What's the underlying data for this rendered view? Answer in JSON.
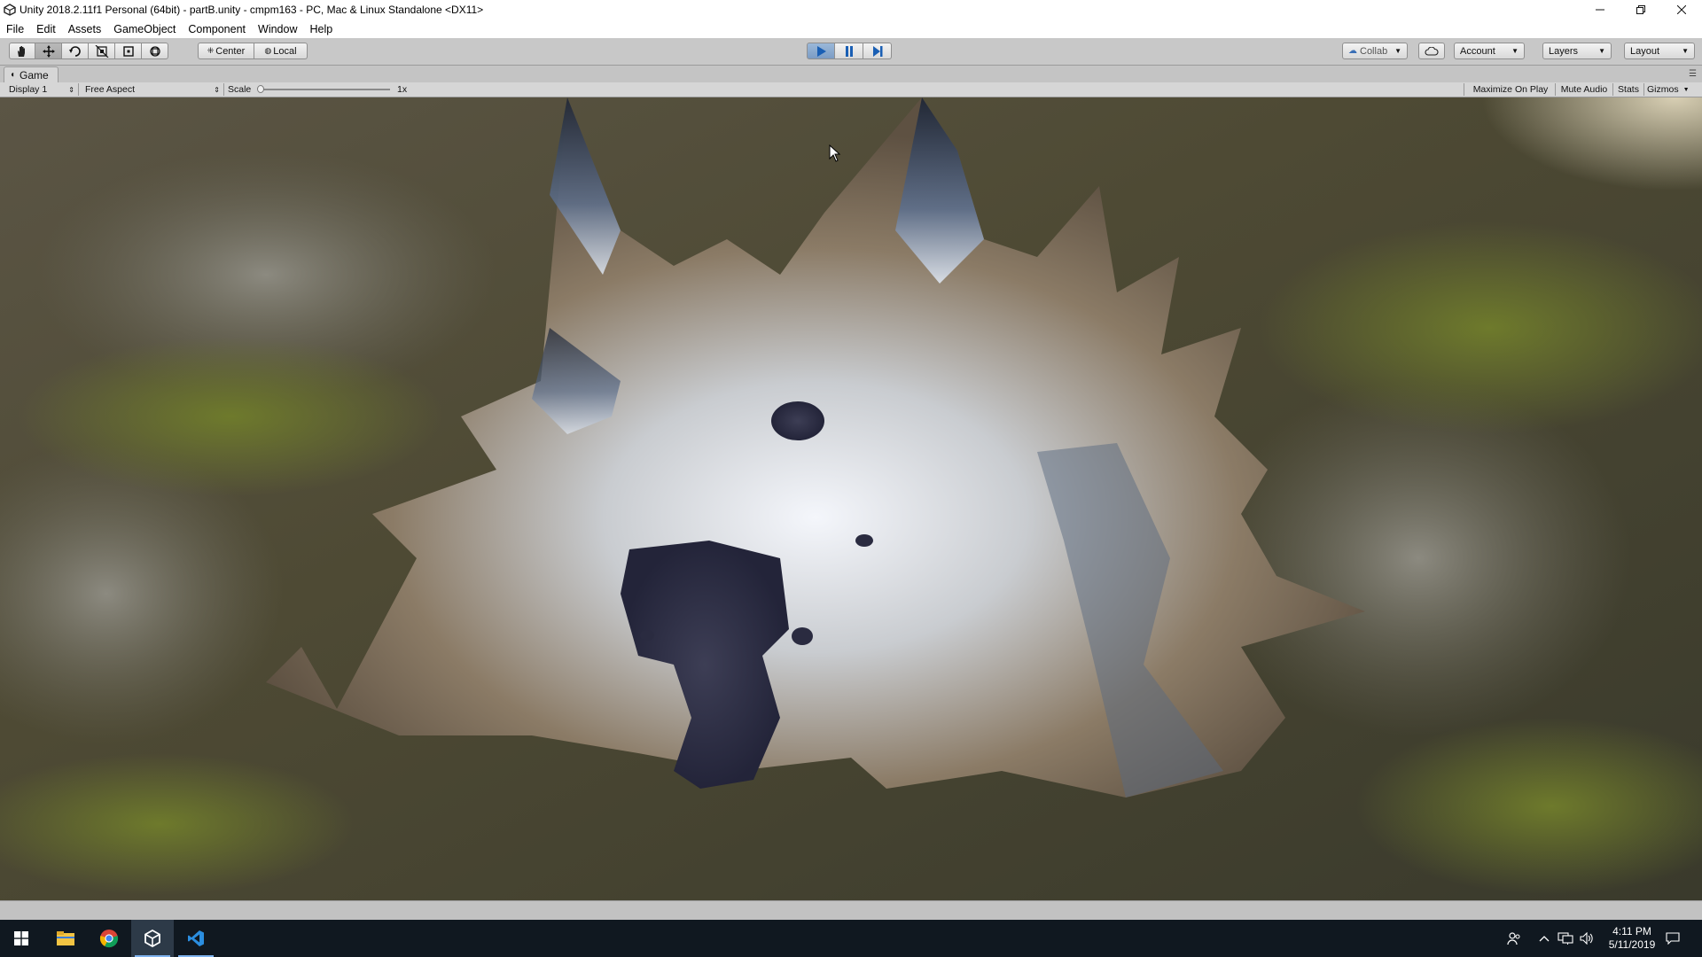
{
  "window": {
    "title": "Unity 2018.2.11f1 Personal (64bit) - partB.unity - cmpm163 - PC, Mac & Linux Standalone <DX11>",
    "controls": [
      "minimize",
      "restore",
      "close"
    ]
  },
  "menubar": {
    "items": [
      "File",
      "Edit",
      "Assets",
      "GameObject",
      "Component",
      "Window",
      "Help"
    ]
  },
  "toolbar": {
    "transform_tools": [
      "hand-icon",
      "move-icon",
      "rotate-icon",
      "scale-icon",
      "rect-tool-icon",
      "transform-icon"
    ],
    "active_tool": "move-icon",
    "pivot_label": "Center",
    "space_label": "Local",
    "play_state": "playing",
    "collab_label": "Collab",
    "account_label": "Account",
    "layers_label": "Layers",
    "layout_label": "Layout"
  },
  "game_view": {
    "tab_label": "Game",
    "display_label": "Display 1",
    "aspect_label": "Free Aspect",
    "scale_label": "Scale",
    "scale_value": "1x",
    "maximize_label": "Maximize On Play",
    "mute_label": "Mute Audio",
    "stats_label": "Stats",
    "gizmos_label": "Gizmos"
  },
  "taskbar": {
    "apps": [
      "start-icon",
      "file-explorer-icon",
      "chrome-icon",
      "unity-icon",
      "vscode-icon"
    ],
    "active_app": "unity-icon",
    "time": "4:11 PM",
    "date": "5/11/2019"
  },
  "colors": {
    "accent_play": "#5b87c4",
    "taskbar_bg": "#101820",
    "editor_bg": "#c2c2c2"
  }
}
